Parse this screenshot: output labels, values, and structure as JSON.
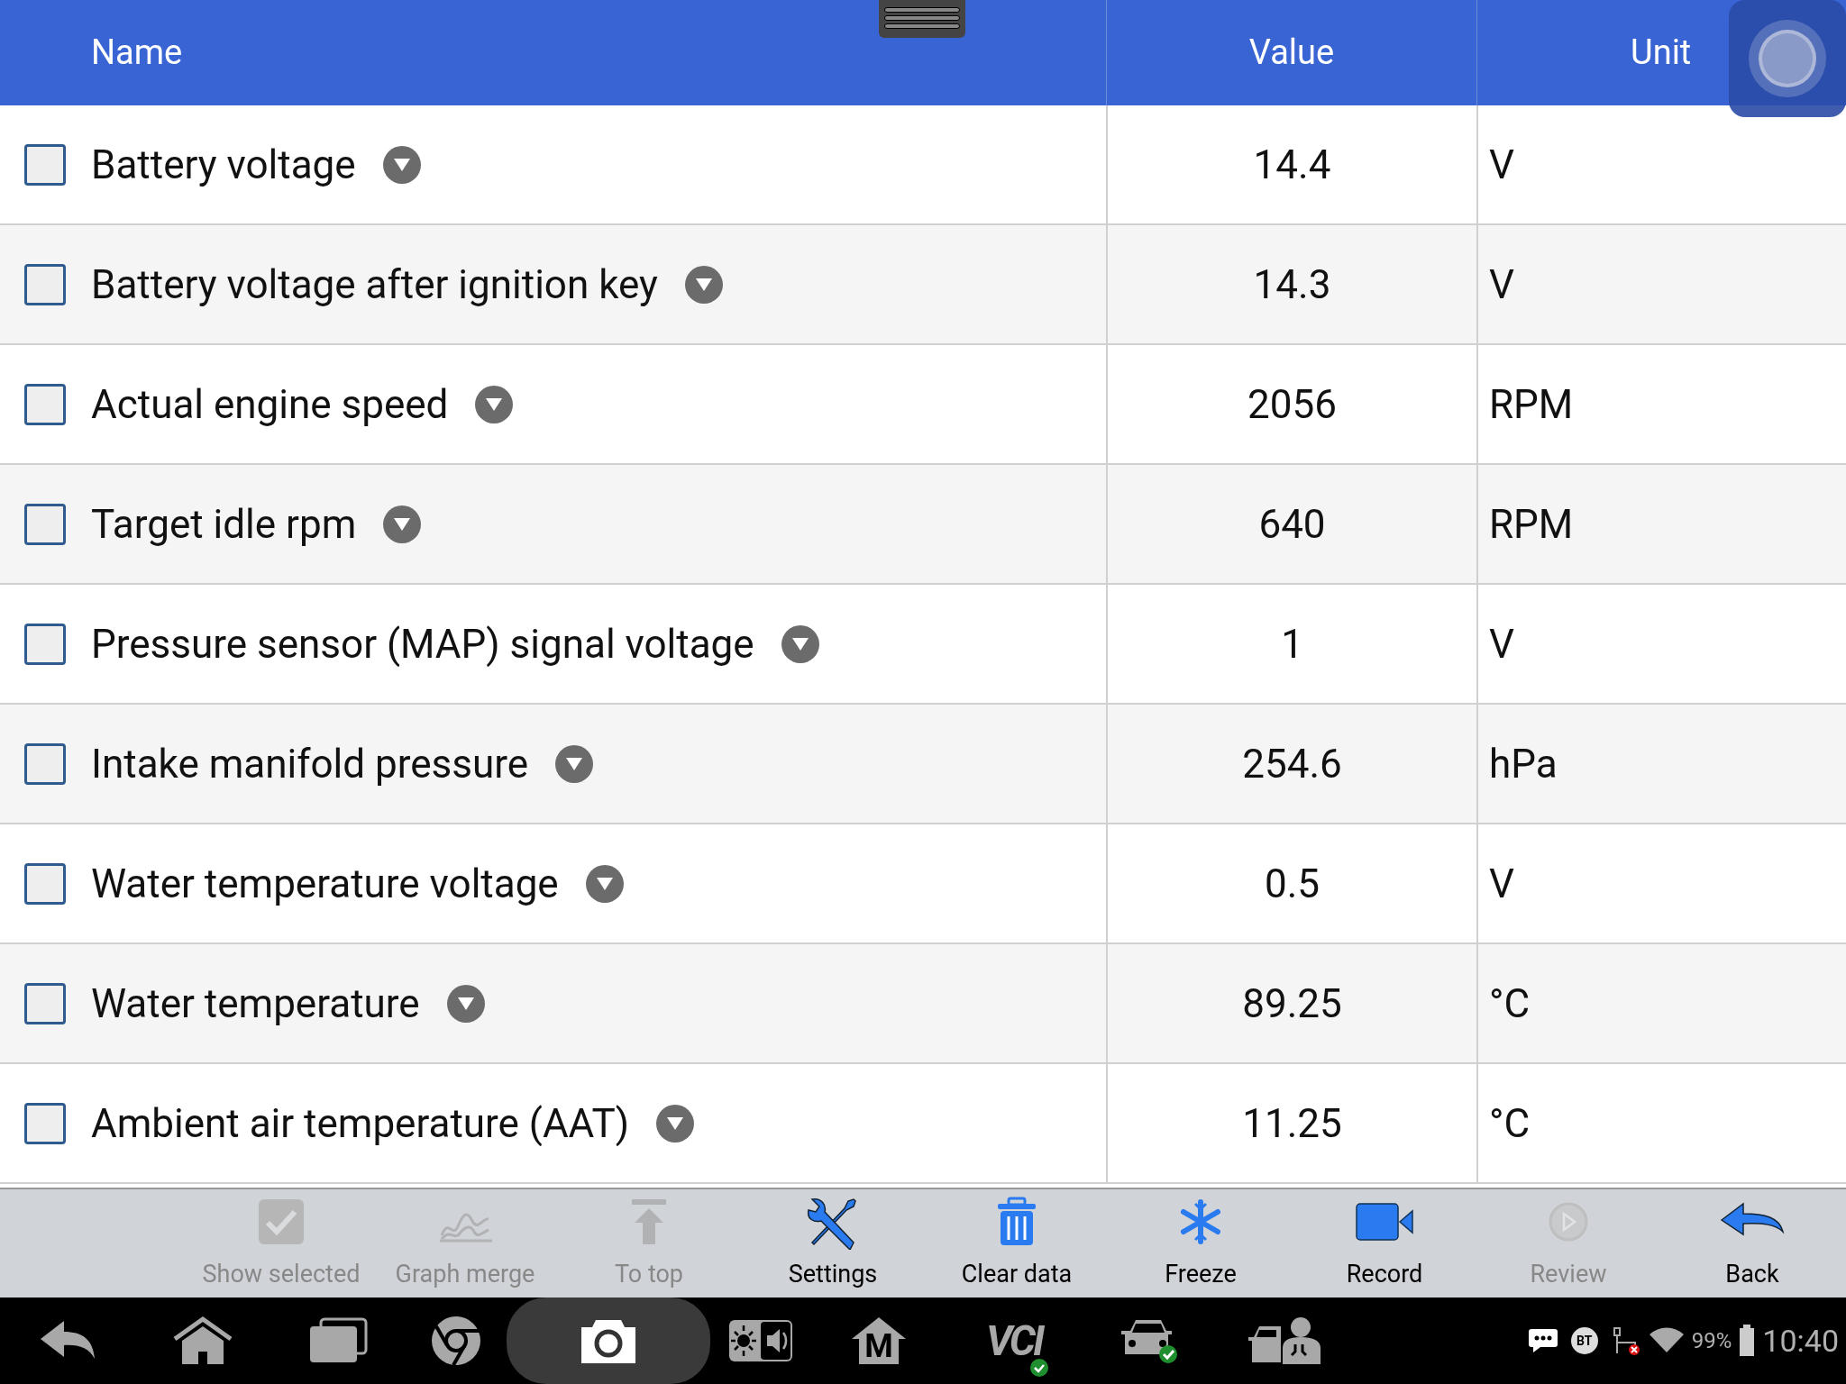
{
  "table": {
    "columns": [
      "Name",
      "Value",
      "Unit"
    ],
    "rows": [
      {
        "name": "Battery voltage",
        "value": "14.4",
        "unit": "V",
        "checked": false
      },
      {
        "name": "Battery voltage after ignition key",
        "value": "14.3",
        "unit": "V",
        "checked": false
      },
      {
        "name": "Actual engine speed",
        "value": "2056",
        "unit": "RPM",
        "checked": false
      },
      {
        "name": "Target idle rpm",
        "value": "640",
        "unit": "RPM",
        "checked": false
      },
      {
        "name": "Pressure sensor (MAP) signal voltage",
        "value": "1",
        "unit": "V",
        "checked": false
      },
      {
        "name": "Intake manifold pressure",
        "value": "254.6",
        "unit": "hPa",
        "checked": false
      },
      {
        "name": "Water temperature voltage",
        "value": "0.5",
        "unit": "V",
        "checked": false
      },
      {
        "name": "Water temperature",
        "value": "89.25",
        "unit": "°C",
        "checked": false
      },
      {
        "name": "Ambient air temperature (AAT)",
        "value": "11.25",
        "unit": "°C",
        "checked": false
      }
    ]
  },
  "toolbar": [
    {
      "label": "Show selected",
      "disabled": true
    },
    {
      "label": "Graph merge",
      "disabled": true
    },
    {
      "label": "To top",
      "disabled": true
    },
    {
      "label": "Settings",
      "disabled": false
    },
    {
      "label": "Clear data",
      "disabled": false
    },
    {
      "label": "Freeze",
      "disabled": false
    },
    {
      "label": "Record",
      "disabled": false
    },
    {
      "label": "Review",
      "disabled": true
    },
    {
      "label": "Back",
      "disabled": false
    }
  ],
  "nav_bar": [
    {
      "selected": false
    },
    {
      "selected": false
    },
    {
      "selected": false
    },
    {
      "selected": false
    },
    {
      "selected": true
    },
    {
      "selected": false
    },
    {
      "selected": false,
      "text": "M"
    },
    {
      "selected": false,
      "text": "VCI"
    },
    {
      "selected": false
    },
    {
      "selected": false
    }
  ],
  "status_bar": {
    "bt": "BT",
    "battery": "99%",
    "time": "10:40"
  }
}
